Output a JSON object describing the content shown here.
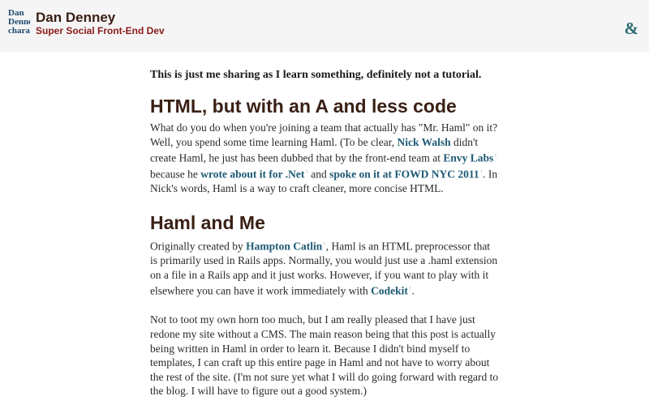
{
  "header": {
    "avatar_alt": "Dan Denney character",
    "title": "Dan Denney",
    "tagline": "Super Social Front-End Dev",
    "menu_symbol": "&"
  },
  "article": {
    "intro": "This is just me sharing as I learn something, definitely not a tutorial.",
    "section1": {
      "heading": "HTML, but with an A and less code",
      "p1_t1": "What do you do when you're joining a team that actually has \"Mr. Haml\" on it? Well, you spend some time learning Haml. (To be clear, ",
      "link_nick": "Nick Walsh",
      "p1_t2": " didn't create Haml, he just has been dubbed that by the front-end team at ",
      "link_envy": "Envy Labs",
      "p1_t3": " because he ",
      "link_wrote": "wrote about it for .Net",
      "p1_t4": " and ",
      "link_spoke": "spoke on it at FOWD NYC 2011",
      "p1_t5": ". In Nick's words, Haml is a way to craft cleaner, more concise HTML."
    },
    "section2": {
      "heading": "Haml and Me",
      "p2_t1": "Originally created by ",
      "link_hampton": "Hampton Catlin",
      "p2_t2": ", Haml is an HTML preprocessor that is primarily used in Rails apps. Normally, you would just use a .haml extension on a file in a Rails app and it just works. However, if you want to play with it elsewhere you can have it work immediately with ",
      "link_codekit": "Codekit",
      "p2_t3": ".",
      "p3": "Not to toot my own horn too much, but I am really pleased that I have just redone my site without a CMS. The main reason being that this post is actually being written in Haml in order to learn it. Because I didn't bind myself to templates, I can craft up this entire page in Haml and not have to worry about the rest of the site. (I'm not sure yet what I will do going forward with regard to the blog. I will have to figure out a good system.)"
    },
    "ext_marker": "↑"
  }
}
